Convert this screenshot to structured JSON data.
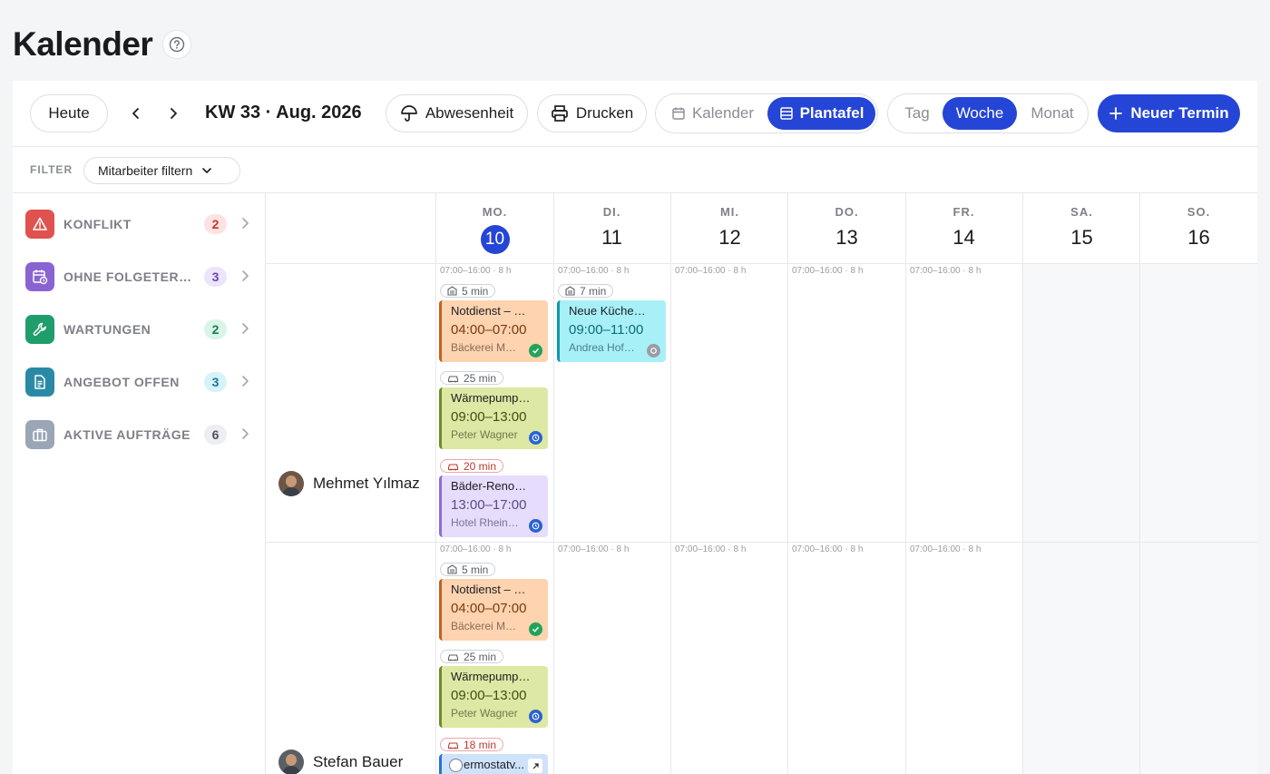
{
  "header": {
    "title": "Kalender"
  },
  "toolbar": {
    "today_label": "Heute",
    "week_label": "KW 33 · Aug. 2026",
    "absence_label": "Abwesenheit",
    "print_label": "Drucken",
    "view_calendar": "Kalender",
    "view_board": "Plantafel",
    "range_day": "Tag",
    "range_week": "Woche",
    "range_month": "Monat",
    "new_label": "Neuer Termin"
  },
  "filter": {
    "label": "FILTER",
    "select_value": "Mitarbeiter filtern"
  },
  "sidebar": {
    "items": [
      {
        "label": "KONFLIKT",
        "count": "2",
        "icon": "alert-triangle-icon",
        "color": "#e0524f"
      },
      {
        "label": "OHNE FOLGETERMIN",
        "count": "3",
        "icon": "calendar-clock-icon",
        "color": "#8a63d2"
      },
      {
        "label": "WARTUNGEN",
        "count": "2",
        "icon": "wrench-icon",
        "color": "#1f9d6b"
      },
      {
        "label": "ANGEBOT OFFEN",
        "count": "3",
        "icon": "document-icon",
        "color": "#2a8aa6"
      },
      {
        "label": "AKTIVE AUFTRÄGE",
        "count": "6",
        "icon": "briefcase-icon",
        "color": "#9aa6b5"
      }
    ]
  },
  "days": [
    {
      "name": "MO.",
      "num": "10"
    },
    {
      "name": "DI.",
      "num": "11"
    },
    {
      "name": "MI.",
      "num": "12"
    },
    {
      "name": "DO.",
      "num": "13"
    },
    {
      "name": "FR.",
      "num": "14"
    },
    {
      "name": "SA.",
      "num": "15"
    },
    {
      "name": "SO.",
      "num": "16"
    }
  ],
  "employees": [
    {
      "name": "Mehmet Yılmaz",
      "hours": [
        "07:00–16:00 · 8 h",
        "07:00–16:00 · 8 h",
        "07:00–16:00 · 8 h",
        "07:00–16:00 · 8 h",
        "07:00–16:00 · 8 h"
      ],
      "mon": {
        "t1": "5 min",
        "e1": {
          "title": "Notdienst – Heizungsausfall",
          "time": "04:00–07:00",
          "client": "Bäckerei Müller"
        },
        "t2": "25 min",
        "e2": {
          "title": "Wärmepumpe Wartung",
          "time": "09:00–13:00",
          "client": "Peter Wagner"
        },
        "t3": "20 min",
        "e3": {
          "title": "Bäder-Renovierung",
          "time": "13:00–17:00",
          "client": "Hotel Rheinblick"
        }
      },
      "tue": {
        "t1": "7 min",
        "e1": {
          "title": "Neue Küche Montage",
          "time": "09:00–11:00",
          "client": "Andrea Hofmann"
        }
      }
    },
    {
      "name": "Stefan Bauer",
      "hours": [
        "07:00–16:00 · 8 h",
        "07:00–16:00 · 8 h",
        "07:00–16:00 · 8 h",
        "07:00–16:00 · 8 h",
        "07:00–16:00 · 8 h"
      ],
      "mon": {
        "t1": "5 min",
        "e1": {
          "title": "Notdienst – Heizungsausfall",
          "time": "04:00–07:00",
          "client": "Bäckerei Müller"
        },
        "t2": "25 min",
        "e2": {
          "title": "Wärmepumpe Wartung",
          "time": "09:00–13:00",
          "client": "Peter Wagner"
        },
        "t3": "18 min",
        "e3": {
          "title": "ermostatv..."
        }
      }
    }
  ]
}
